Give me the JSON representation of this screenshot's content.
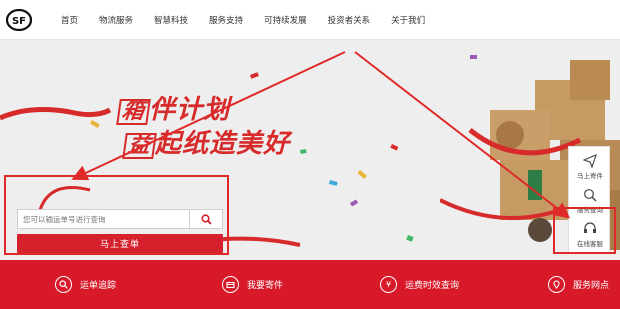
{
  "header": {
    "logo_text": "SF",
    "nav": [
      "首页",
      "物流服务",
      "智慧科技",
      "服务支持",
      "可持续发展",
      "投资者关系",
      "关于我们"
    ]
  },
  "banner": {
    "slogan_box1": "箱",
    "slogan_line1": "伴计划",
    "slogan_box2": "益",
    "slogan_line2": "起纸造美好"
  },
  "query": {
    "placeholder": "您可以输运单号进行查询",
    "submit_label": "马上查单"
  },
  "side": [
    {
      "label": "马上寄件",
      "icon": "paper-plane-icon"
    },
    {
      "label": "服务查询",
      "icon": "search-icon"
    },
    {
      "label": "在线客服",
      "icon": "headset-icon"
    }
  ],
  "bottom": [
    {
      "label": "运单追踪",
      "icon": "search-icon"
    },
    {
      "label": "我要寄件",
      "icon": "package-icon"
    },
    {
      "label": "运费时效查询",
      "icon": "yen-icon"
    },
    {
      "label": "服务网点",
      "icon": "location-icon"
    }
  ],
  "colors": {
    "brand_red": "#d6202c",
    "annotation_red": "#e02a2a"
  }
}
